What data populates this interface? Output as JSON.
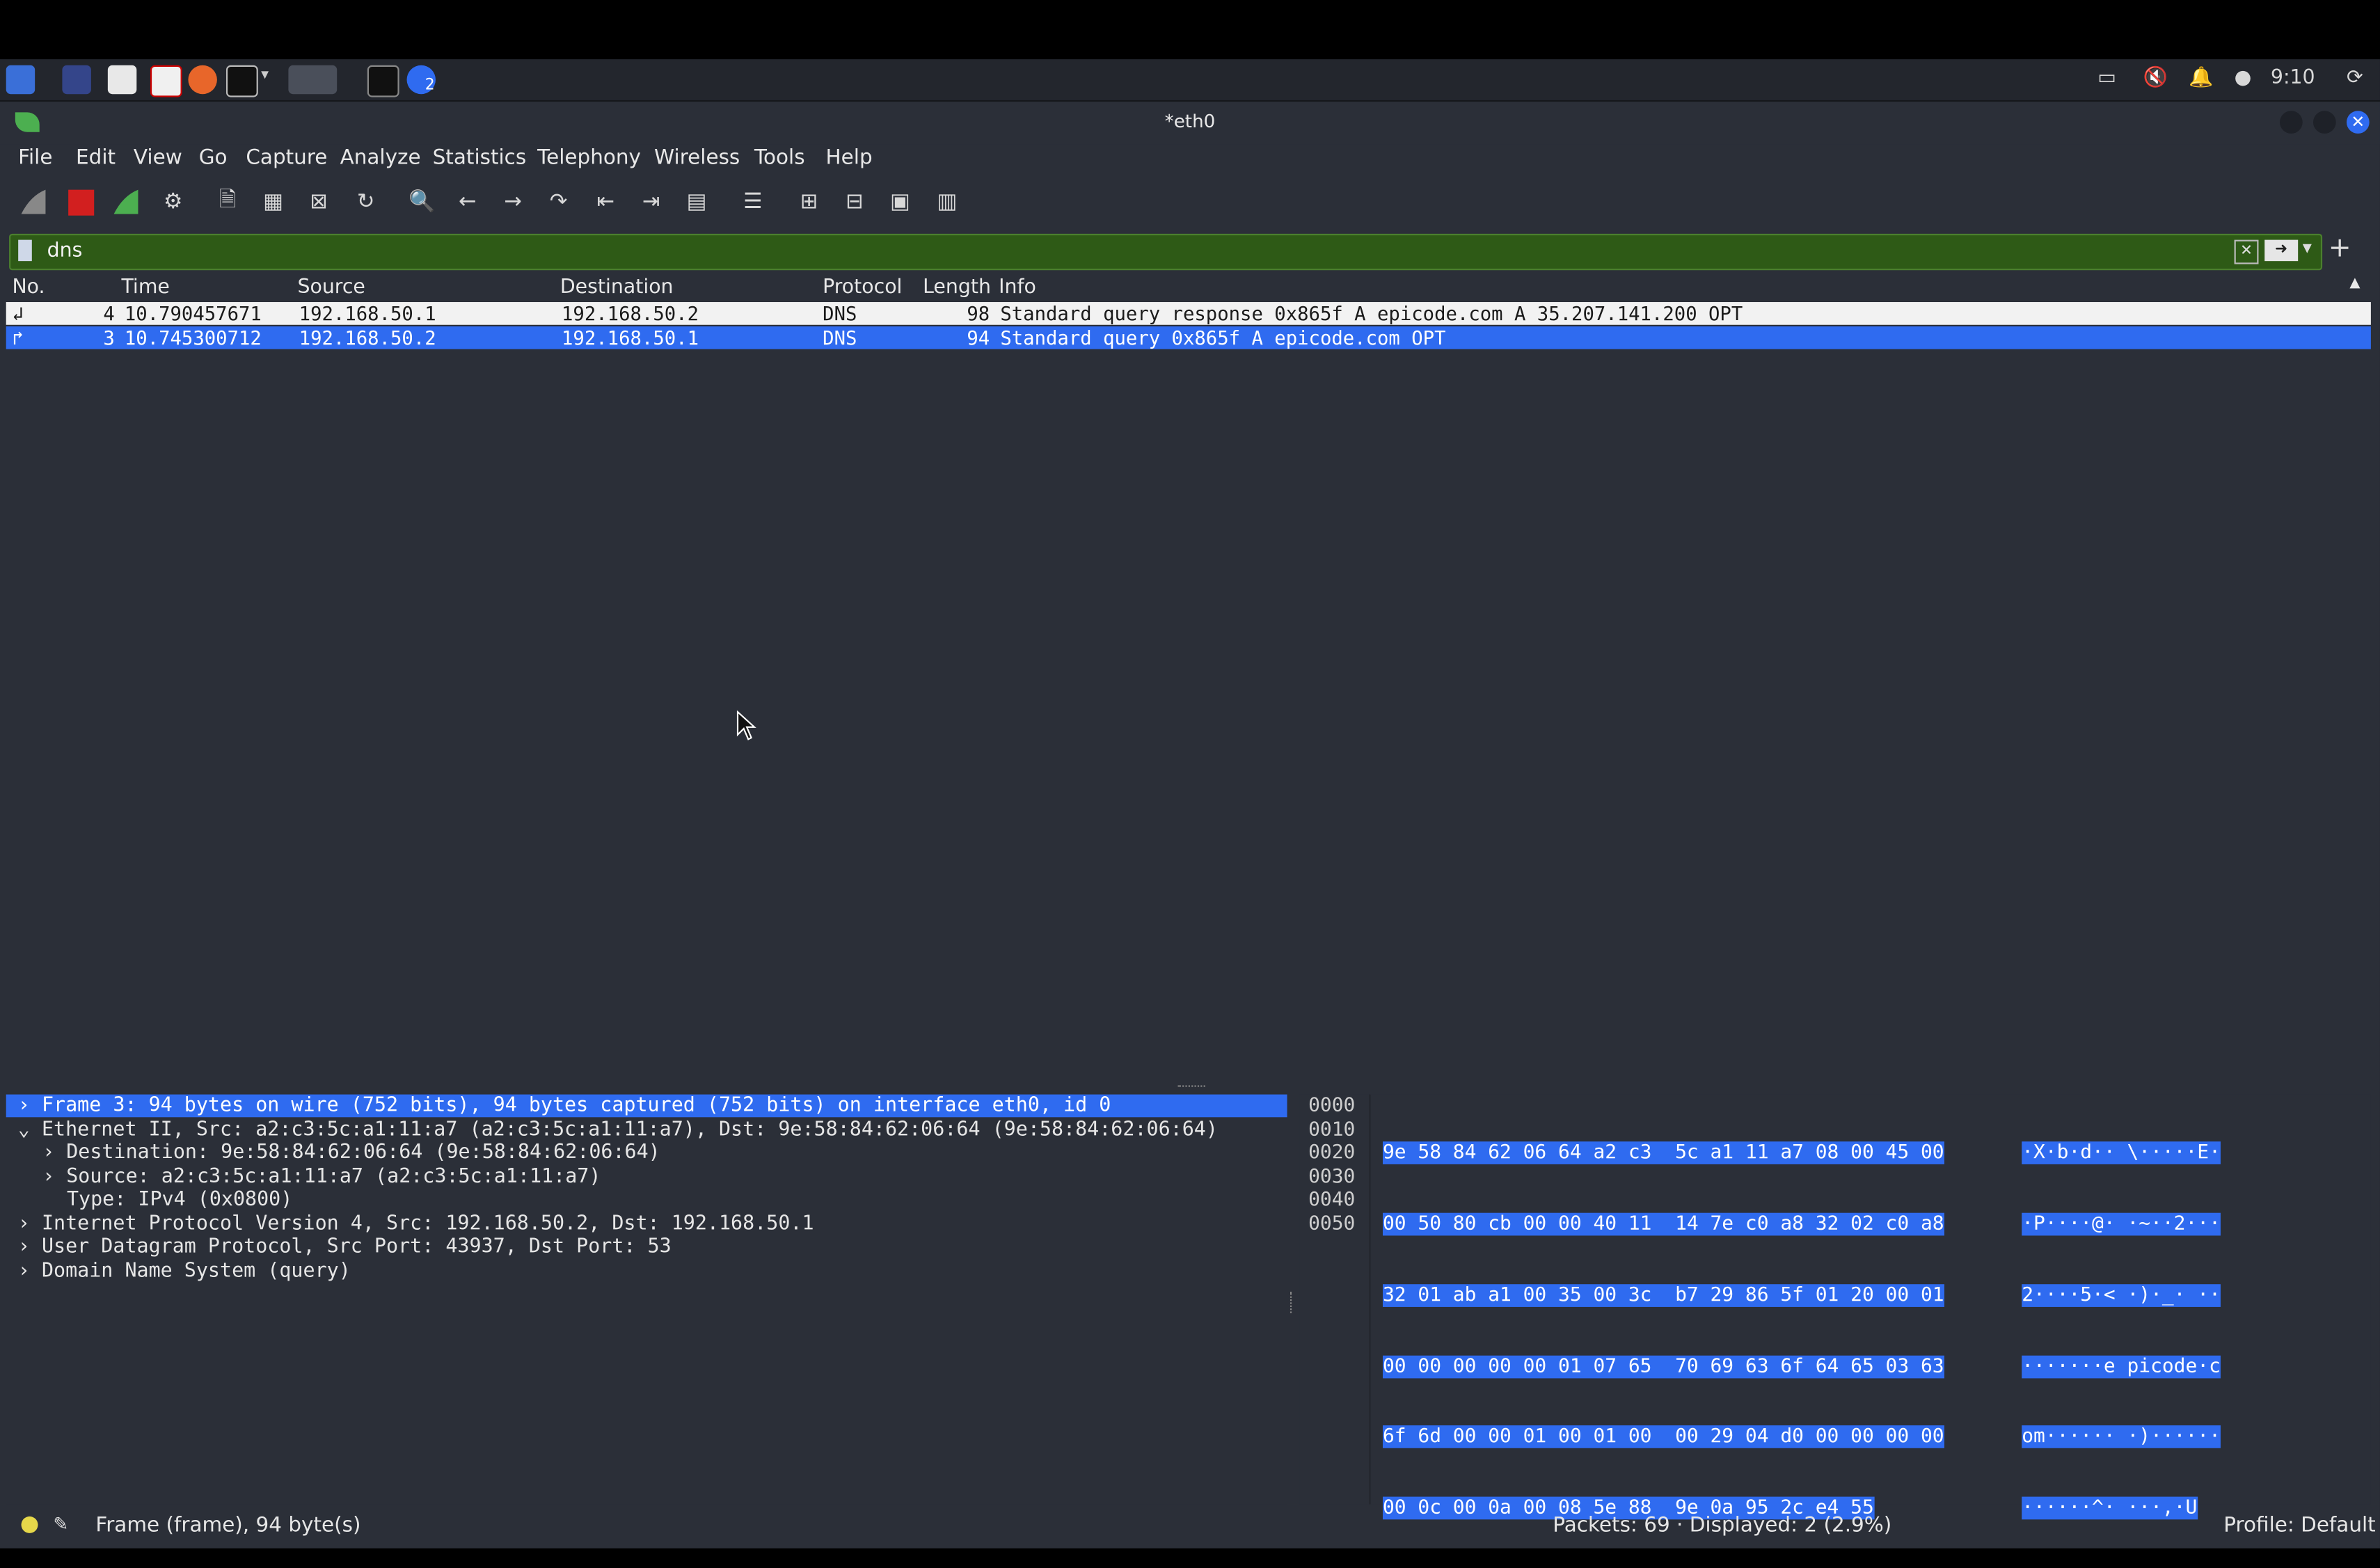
{
  "colors": {
    "accent_selected": "#2f6bf0",
    "filter_bg": "#2e5a16",
    "window_bg": "#2b2f38"
  },
  "taskbar": {
    "clock": "9:10",
    "workspace_badge": "2"
  },
  "window": {
    "title": "*eth0"
  },
  "menu": {
    "file": "File",
    "edit": "Edit",
    "view": "View",
    "go": "Go",
    "capture": "Capture",
    "analyze": "Analyze",
    "statistics": "Statistics",
    "telephony": "Telephony",
    "wireless": "Wireless",
    "tools": "Tools",
    "help": "Help"
  },
  "filter": {
    "value": "dns"
  },
  "packet_list": {
    "columns": [
      "No.",
      "Time",
      "Source",
      "Destination",
      "Protocol",
      "Length",
      "Info"
    ],
    "rows": [
      {
        "no": "4",
        "time": "10.790457671",
        "source": "192.168.50.1",
        "destination": "192.168.50.2",
        "protocol": "DNS",
        "length": "98",
        "info": "Standard query response 0x865f A epicode.com A 35.207.141.200 OPT",
        "selected": false
      },
      {
        "no": "3",
        "time": "10.745300712",
        "source": "192.168.50.2",
        "destination": "192.168.50.1",
        "protocol": "DNS",
        "length": "94",
        "info": "Standard query 0x865f A epicode.com OPT",
        "selected": true
      }
    ]
  },
  "details": {
    "frame": "Frame 3: 94 bytes on wire (752 bits), 94 bytes captured (752 bits) on interface eth0, id 0",
    "ethernet": "Ethernet II, Src: a2:c3:5c:a1:11:a7 (a2:c3:5c:a1:11:a7), Dst: 9e:58:84:62:06:64 (9e:58:84:62:06:64)",
    "eth_dst": "Destination: 9e:58:84:62:06:64 (9e:58:84:62:06:64)",
    "eth_src": "Source: a2:c3:5c:a1:11:a7 (a2:c3:5c:a1:11:a7)",
    "eth_type": "Type: IPv4 (0x0800)",
    "ip": "Internet Protocol Version 4, Src: 192.168.50.2, Dst: 192.168.50.1",
    "udp": "User Datagram Protocol, Src Port: 43937, Dst Port: 53",
    "dns": "Domain Name System (query)"
  },
  "hex": {
    "offsets": [
      "0000",
      "0010",
      "0020",
      "0030",
      "0040",
      "0050"
    ],
    "bytes": [
      "9e 58 84 62 06 64 a2 c3  5c a1 11 a7 08 00 45 00",
      "00 50 80 cb 00 00 40 11  14 7e c0 a8 32 02 c0 a8",
      "32 01 ab a1 00 35 00 3c  b7 29 86 5f 01 20 00 01",
      "00 00 00 00 00 01 07 65  70 69 63 6f 64 65 03 63",
      "6f 6d 00 00 01 00 01 00  00 29 04 d0 00 00 00 00",
      "00 0c 00 0a 00 08 5e 88  9e 0a 95 2c e4 55"
    ],
    "ascii": [
      "·X·b·d·· \\·····E·",
      "·P····@· ·~··2···",
      "2····5·< ·)·_· ··",
      "·······e picode·c",
      "om······ ·)······",
      "······^· ···,·U"
    ]
  },
  "status": {
    "frame_info": "Frame (frame), 94 byte(s)",
    "packets": "Packets: 69 · Displayed: 2 (2.9%)",
    "profile": "Profile: Default"
  }
}
